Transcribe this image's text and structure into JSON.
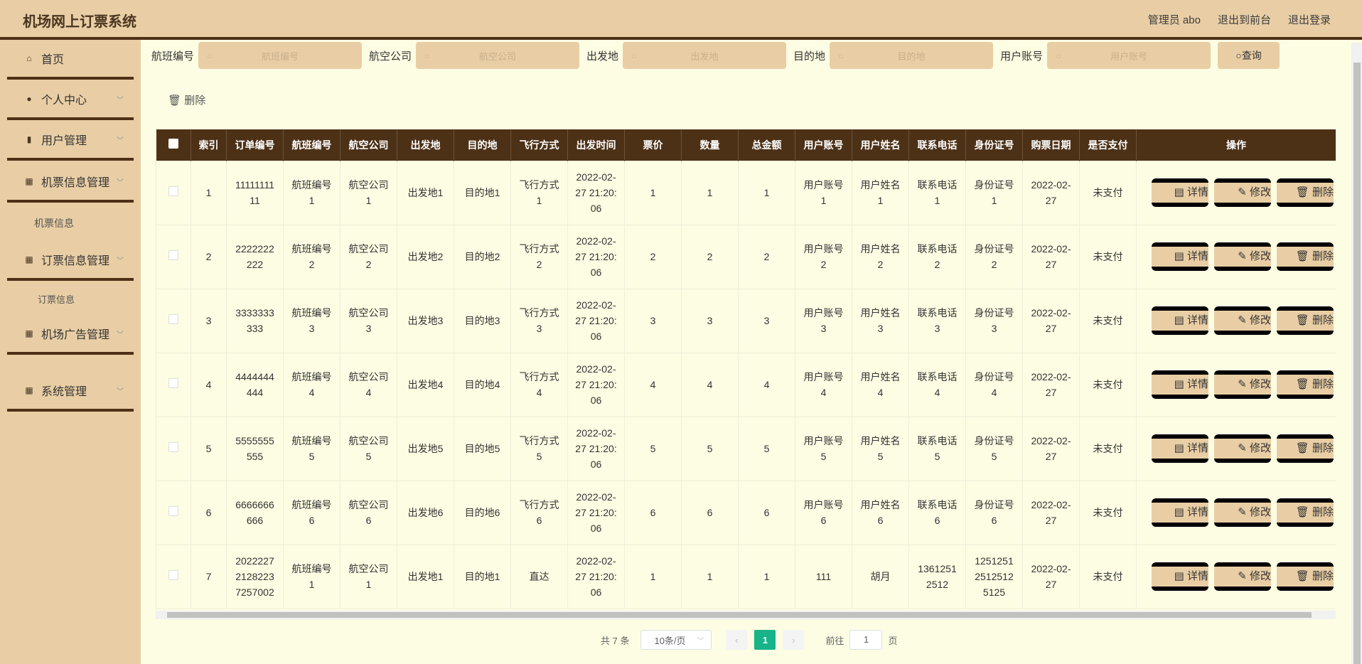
{
  "header": {
    "title": "机场网上订票系统",
    "user": "管理员 abo",
    "front": "退出到前台",
    "logout": "退出登录"
  },
  "sidebar": {
    "items": [
      {
        "label": "首页",
        "icon": "home-icon"
      },
      {
        "label": "个人中心",
        "icon": "user-icon"
      },
      {
        "label": "用户管理",
        "icon": "bar-chart-icon"
      },
      {
        "label": "机票信息管理",
        "icon": "grid-icon"
      },
      {
        "label": "订票信息管理",
        "icon": "grid-icon"
      },
      {
        "label": "机场广告管理",
        "icon": "grid-icon"
      },
      {
        "label": "系统管理",
        "icon": "grid-icon"
      }
    ],
    "subs": [
      "机票信息",
      "订票信息"
    ]
  },
  "search": {
    "fields": [
      {
        "label": "航班编号",
        "placeholder": "航班编号"
      },
      {
        "label": "航空公司",
        "placeholder": "航空公司"
      },
      {
        "label": "出发地",
        "placeholder": "出发地"
      },
      {
        "label": "目的地",
        "placeholder": "目的地"
      },
      {
        "label": "用户账号",
        "placeholder": "用户账号"
      }
    ],
    "button": "查询"
  },
  "toolbar": {
    "delete": "删除"
  },
  "table": {
    "columns": [
      "索引",
      "订单编号",
      "航班编号",
      "航空公司",
      "出发地",
      "目的地",
      "飞行方式",
      "出发时间",
      "票价",
      "数量",
      "总金额",
      "用户账号",
      "用户姓名",
      "联系电话",
      "身份证号",
      "购票日期",
      "是否支付",
      "操作"
    ],
    "actions": [
      "详情",
      "修改",
      "删除"
    ],
    "rows": [
      [
        "1",
        "1111111111",
        "航班编号1",
        "航空公司1",
        "出发地1",
        "目的地1",
        "飞行方式1",
        "2022-02-27 21:20:06",
        "1",
        "1",
        "1",
        "用户账号1",
        "用户姓名1",
        "联系电话1",
        "身份证号1",
        "2022-02-27",
        "未支付"
      ],
      [
        "2",
        "2222222222",
        "航班编号2",
        "航空公司2",
        "出发地2",
        "目的地2",
        "飞行方式2",
        "2022-02-27 21:20:06",
        "2",
        "2",
        "2",
        "用户账号2",
        "用户姓名2",
        "联系电话2",
        "身份证号2",
        "2022-02-27",
        "未支付"
      ],
      [
        "3",
        "3333333333",
        "航班编号3",
        "航空公司3",
        "出发地3",
        "目的地3",
        "飞行方式3",
        "2022-02-27 21:20:06",
        "3",
        "3",
        "3",
        "用户账号3",
        "用户姓名3",
        "联系电话3",
        "身份证号3",
        "2022-02-27",
        "未支付"
      ],
      [
        "4",
        "4444444444",
        "航班编号4",
        "航空公司4",
        "出发地4",
        "目的地4",
        "飞行方式4",
        "2022-02-27 21:20:06",
        "4",
        "4",
        "4",
        "用户账号4",
        "用户姓名4",
        "联系电话4",
        "身份证号4",
        "2022-02-27",
        "未支付"
      ],
      [
        "5",
        "5555555555",
        "航班编号5",
        "航空公司5",
        "出发地5",
        "目的地5",
        "飞行方式5",
        "2022-02-27 21:20:06",
        "5",
        "5",
        "5",
        "用户账号5",
        "用户姓名5",
        "联系电话5",
        "身份证号5",
        "2022-02-27",
        "未支付"
      ],
      [
        "6",
        "6666666666",
        "航班编号6",
        "航空公司6",
        "出发地6",
        "目的地6",
        "飞行方式6",
        "2022-02-27 21:20:06",
        "6",
        "6",
        "6",
        "用户账号6",
        "用户姓名6",
        "联系电话6",
        "身份证号6",
        "2022-02-27",
        "未支付"
      ],
      [
        "7",
        "202222721282237257002",
        "航班编号1",
        "航空公司1",
        "出发地1",
        "目的地1",
        "直达",
        "2022-02-27 21:20:06",
        "1",
        "1",
        "1",
        "111",
        "胡月",
        "13612512512",
        "125125125125125125",
        "2022-02-27",
        "未支付"
      ]
    ]
  },
  "pagination": {
    "total": "共 7 条",
    "page_size": "10条/页",
    "current": "1",
    "goto_label": "前往",
    "goto_value": "1",
    "page_suffix": "页",
    "accent": "#17b389"
  }
}
